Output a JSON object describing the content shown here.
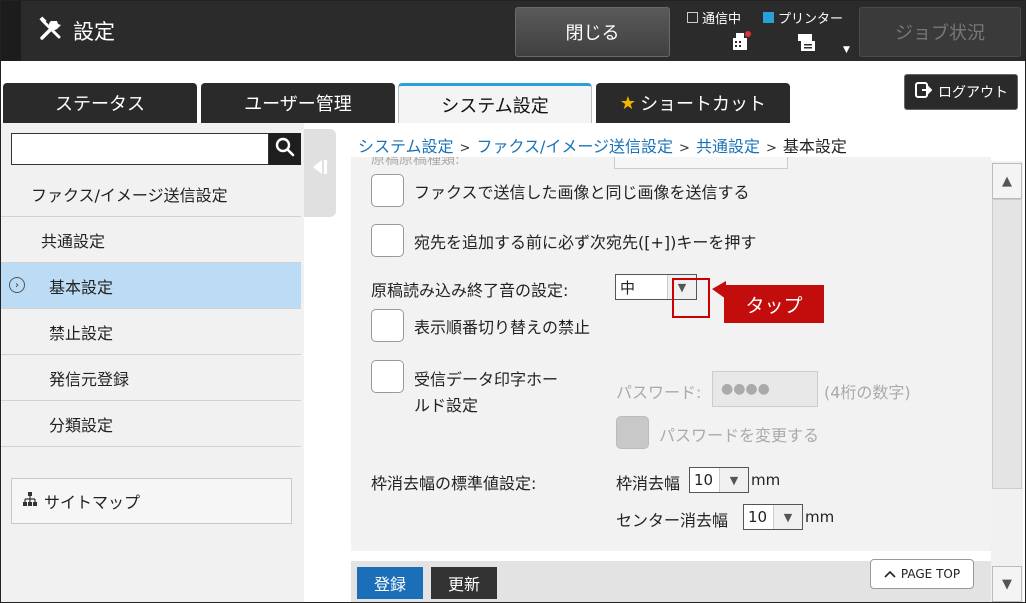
{
  "header": {
    "title": "設定",
    "close_label": "閉じる",
    "status_comm": "通信中",
    "status_printer": "プリンター",
    "job_status_label": "ジョブ状況"
  },
  "tabs": [
    {
      "label": "ステータス",
      "active": false
    },
    {
      "label": "ユーザー管理",
      "active": false
    },
    {
      "label": "システム設定",
      "active": true
    },
    {
      "label": "ショートカット",
      "active": false
    }
  ],
  "logout_label": "ログアウト",
  "sidebar": {
    "search_value": "",
    "items": [
      {
        "label": "ファクス/イメージ送信設定",
        "level": 0
      },
      {
        "label": "共通設定",
        "level": 1
      },
      {
        "label": "基本設定",
        "level": 1,
        "active": true
      },
      {
        "label": "禁止設定",
        "level": 1
      },
      {
        "label": "発信元登録",
        "level": 1
      },
      {
        "label": "分類設定",
        "level": 1
      }
    ],
    "sitemap_label": "サイトマップ"
  },
  "breadcrumb": {
    "items": [
      "システム設定",
      "ファクス/イメージ送信設定",
      "共通設定",
      "基本設定"
    ],
    "separator": ">"
  },
  "settings": {
    "partial_row_label": "原稿原稿種類:",
    "send_same_image_fax": "ファクスで送信した画像と同じ画像を送信する",
    "press_next_address_key": "宛先を追加する前に必ず次宛先([+])キーを押す",
    "scan_end_sound_label": "原稿読み込み終了音の設定:",
    "scan_end_sound_value": "中",
    "disable_display_order_switch": "表示順番切り替えの禁止",
    "hold_print_line1": "受信データ印字ホー",
    "hold_print_line2": "ルド設定",
    "password_label": "パスワード:",
    "password_value": "●●●●",
    "password_hint": "(4桁の数字)",
    "change_password_label": "パスワードを変更する",
    "erase_width_label": "枠消去幅の標準値設定:",
    "edge_erase_label": "枠消去幅",
    "edge_erase_value": "10",
    "edge_erase_unit": "mm",
    "center_erase_label": "センター消去幅",
    "center_erase_value": "10",
    "center_erase_unit": "mm"
  },
  "callout_label": "タップ",
  "buttons": {
    "register": "登録",
    "update": "更新",
    "page_top": "PAGE TOP"
  },
  "colors": {
    "accent_blue": "#1a6fb8",
    "active_nav": "#bcdcf6",
    "callout_red": "#c30d0d"
  }
}
